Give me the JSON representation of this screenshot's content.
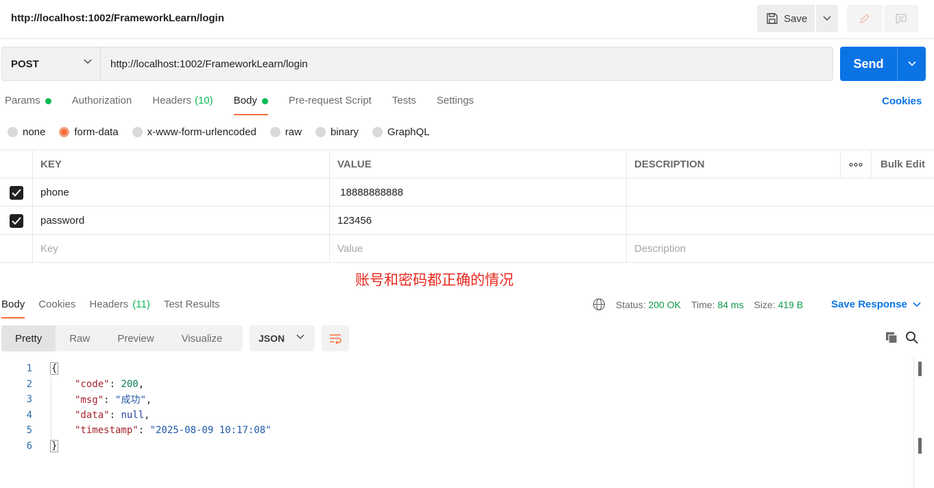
{
  "header": {
    "title": "http://localhost:1002/FrameworkLearn/login",
    "save_label": "Save"
  },
  "request": {
    "method": "POST",
    "url": "http://localhost:1002/FrameworkLearn/login",
    "send_label": "Send"
  },
  "request_tabs": {
    "params": "Params",
    "authorization": "Authorization",
    "headers": "Headers",
    "headers_count": "(10)",
    "body": "Body",
    "pre_request": "Pre-request Script",
    "tests": "Tests",
    "settings": "Settings",
    "cookies": "Cookies"
  },
  "body_types": [
    "none",
    "form-data",
    "x-www-form-urlencoded",
    "raw",
    "binary",
    "GraphQL"
  ],
  "body_type_selected": "form-data",
  "params_table": {
    "headers": {
      "key": "KEY",
      "value": "VALUE",
      "description": "DESCRIPTION",
      "bulk_edit": "Bulk Edit"
    },
    "rows": [
      {
        "key": "phone",
        "value": " 18888888888",
        "description": ""
      },
      {
        "key": "password",
        "value": "123456",
        "description": ""
      }
    ],
    "placeholders": {
      "key": "Key",
      "value": "Value",
      "description": "Description"
    }
  },
  "annotation": "账号和密码都正确的情况",
  "response": {
    "tabs": {
      "body": "Body",
      "cookies": "Cookies",
      "headers": "Headers",
      "headers_count": "(11)",
      "test_results": "Test Results"
    },
    "status_label": "Status:",
    "status_value": "200 OK",
    "time_label": "Time:",
    "time_value": "84 ms",
    "size_label": "Size:",
    "size_value": "419 B",
    "save_response": "Save Response",
    "view_modes": [
      "Pretty",
      "Raw",
      "Preview",
      "Visualize"
    ],
    "format": "JSON",
    "json": {
      "open_brace": "{",
      "close_brace": "}",
      "code_key": "\"code\"",
      "code_val": "200",
      "msg_key": "\"msg\"",
      "msg_val": "\"成功\"",
      "data_key": "\"data\"",
      "data_val": "null",
      "timestamp_key": "\"timestamp\"",
      "timestamp_val": "\"2025-08-09 10:17:08\""
    },
    "line_numbers": [
      "1",
      "2",
      "3",
      "4",
      "5",
      "6"
    ]
  },
  "colors": {
    "accent": "#ff6c37",
    "primary": "#0b74e5",
    "success": "#0cbb52",
    "annotation": "#e8281e"
  }
}
